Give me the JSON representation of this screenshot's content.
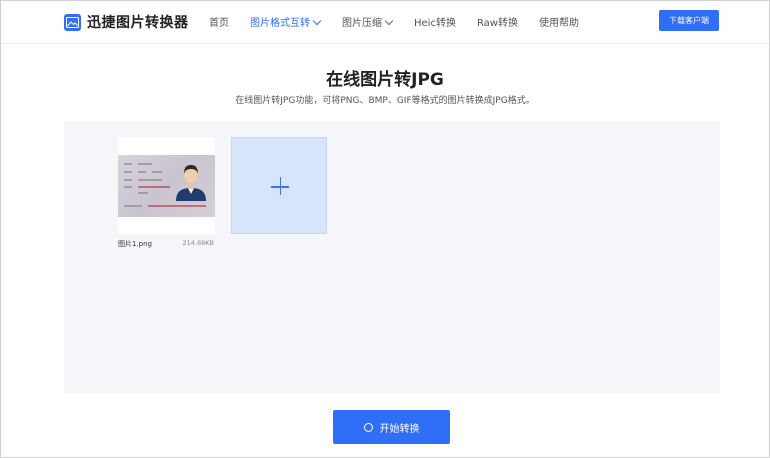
{
  "app": {
    "name": "迅捷图片转换器"
  },
  "nav": {
    "items": [
      {
        "label": "首页",
        "active": false,
        "dropdown": false
      },
      {
        "label": "图片格式互转",
        "active": true,
        "dropdown": true
      },
      {
        "label": "图片压缩",
        "active": false,
        "dropdown": true
      },
      {
        "label": "Heic转换",
        "active": false,
        "dropdown": false
      },
      {
        "label": "Raw转换",
        "active": false,
        "dropdown": false
      },
      {
        "label": "使用帮助",
        "active": false,
        "dropdown": false
      }
    ],
    "download_label": "下载客户端"
  },
  "page": {
    "title": "在线图片转JPG",
    "subtitle": "在线图片转JPG功能，可将PNG、BMP、GIF等格式的图片转换成JPG格式。"
  },
  "files": [
    {
      "name": "图片1.png",
      "size": "214.69KB"
    }
  ],
  "actions": {
    "start_label": "开始转换"
  },
  "colors": {
    "accent": "#2f6ef6",
    "add_box": "#d6e5fb",
    "area_bg": "#f4f6f9"
  }
}
